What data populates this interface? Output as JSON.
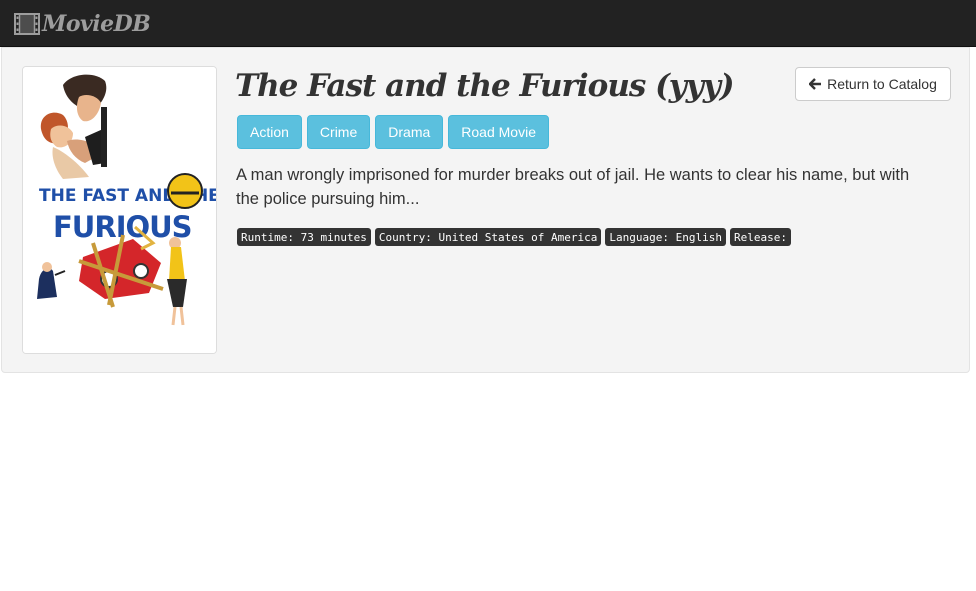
{
  "navbar": {
    "brand": "MovieDB",
    "brand_icon": "film-icon",
    "background": "#222222"
  },
  "movie": {
    "title": "The Fast and the Furious (yyy)",
    "poster": {
      "title_line_1": "THE FAST AND THE",
      "title_line_2": "FURIOUS",
      "accent": "#1f4fa8"
    },
    "genres": [
      "Action",
      "Crime",
      "Drama",
      "Road Movie"
    ],
    "genre_color": "#5bc0de",
    "description": "A man wrongly imprisoned for murder breaks out of jail. He wants to clear his name, but with the police pursuing him...",
    "tags": [
      "Runtime: 73 minutes",
      "Country: United States of America",
      "Language: English",
      "Release:"
    ]
  },
  "actions": {
    "return_label": "Return to Catalog",
    "return_icon": "arrow-left-icon"
  }
}
